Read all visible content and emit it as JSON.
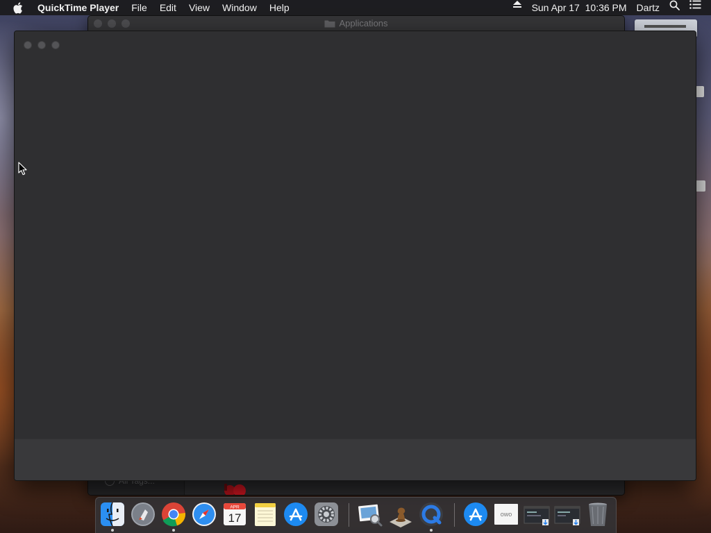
{
  "menubar": {
    "app_name": "QuickTime Player",
    "menus": [
      "File",
      "Edit",
      "View",
      "Window",
      "Help"
    ],
    "datetime": "Sun Apr 17  10:36 PM",
    "user": "Dartz"
  },
  "finder_window": {
    "title": "Applications",
    "sidebar_footer": "All Tags..."
  },
  "quicktime_window": {
    "title": ""
  },
  "dock": {
    "items": [
      {
        "name": "Finder",
        "icon": "finder-icon",
        "running": true
      },
      {
        "name": "Launchpad",
        "icon": "launchpad-icon",
        "running": false
      },
      {
        "name": "Google Chrome",
        "icon": "chrome-icon",
        "running": true
      },
      {
        "name": "Safari",
        "icon": "safari-icon",
        "running": false
      },
      {
        "name": "Calendar",
        "icon": "calendar-icon",
        "running": false,
        "month": "APR",
        "day": "17"
      },
      {
        "name": "Notes",
        "icon": "notes-icon",
        "running": false
      },
      {
        "name": "App Store",
        "icon": "app-store-icon",
        "running": false
      },
      {
        "name": "System Preferences",
        "icon": "system-preferences-icon",
        "running": false
      },
      {
        "name": "Preview",
        "icon": "preview-icon",
        "running": false
      },
      {
        "name": "Chess",
        "icon": "chess-icon",
        "running": false
      },
      {
        "name": "QuickTime Player",
        "icon": "quicktime-icon",
        "running": true
      },
      {
        "name": "App Store",
        "icon": "app-store-icon",
        "running": false
      },
      {
        "name": "Document",
        "icon": "document-icon",
        "running": false,
        "label": "owo"
      },
      {
        "name": "Window thumbnail 1",
        "icon": "window-thumbnail-icon",
        "running": false
      },
      {
        "name": "Window thumbnail 2",
        "icon": "window-thumbnail-icon",
        "running": false
      },
      {
        "name": "Trash",
        "icon": "trash-icon",
        "running": false
      }
    ]
  },
  "colors": {
    "menubar_bg": "#1c1c1e",
    "window_bg": "#2f2f31",
    "controls_bg": "#39393b"
  }
}
